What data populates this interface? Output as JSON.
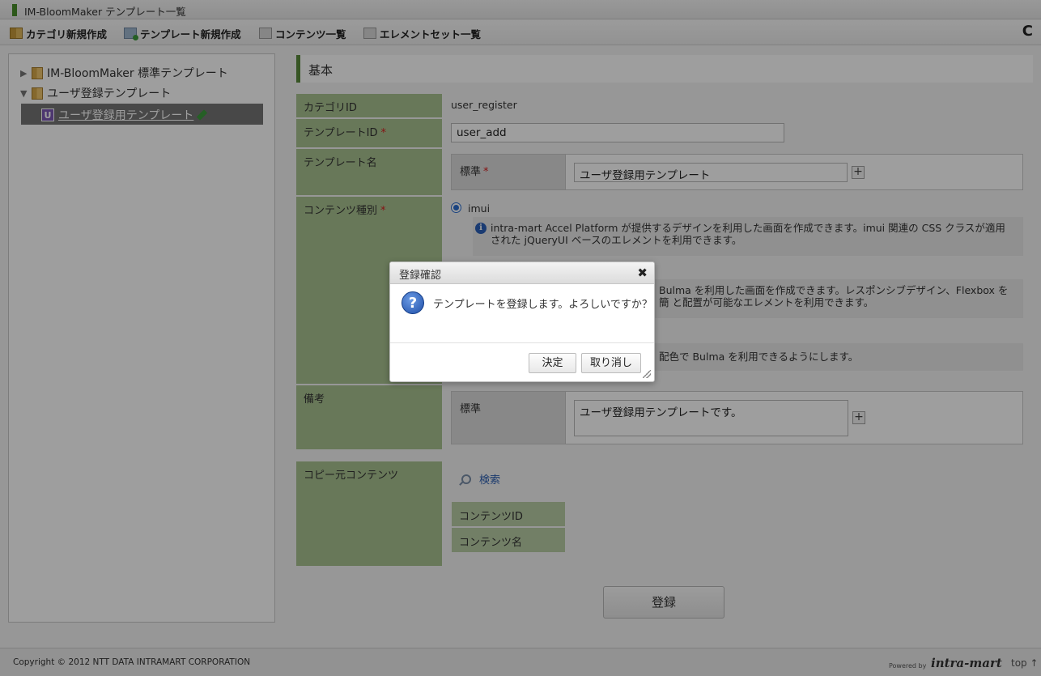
{
  "window": {
    "title": "IM-BloomMaker テンプレート一覧"
  },
  "toolbar": {
    "category_new": "カテゴリ新規作成",
    "template_new": "テンプレート新規作成",
    "contents_list": "コンテンツ一覧",
    "elementset_list": "エレメントセット一覧",
    "reload_icon": "C"
  },
  "tree": {
    "items": [
      {
        "label": "IM-BloomMaker 標準テンプレート",
        "expanded": false
      },
      {
        "label": "ユーザ登録テンプレート",
        "expanded": true
      },
      {
        "label": "ユーザ登録用テンプレート",
        "badge": "U",
        "selected": true
      }
    ]
  },
  "form": {
    "section_title": "基本",
    "category_id_label": "カテゴリID",
    "category_id_value": "user_register",
    "template_id_label": "テンプレートID",
    "template_id_value": "user_add",
    "template_name_label": "テンプレート名",
    "template_name_locale": "標準",
    "template_name_value": "ユーザ登録用テンプレート",
    "content_type_label": "コンテンツ種別",
    "content_type_selected": "imui",
    "imui_description": "intra-mart Accel Platform が提供するデザインを利用した画面を作成できます。imui 関連の CSS クラスが適用された jQueryUI ベースのエレメントを利用できます。",
    "bulma_description_partial": "Bulma を利用した画面を作成できます。レスポンシブデザイン、Flexbox を簡 と配置が可能なエレメントを利用できます。",
    "third_description_partial": "配色で Bulma を利用できるようにします。",
    "remarks_label": "備考",
    "remarks_locale": "標準",
    "remarks_value": "ユーザ登録用テンプレートです。",
    "copy_source_label": "コピー元コンテンツ",
    "search_link": "検索",
    "content_id_label": "コンテンツID",
    "content_name_label": "コンテンツ名",
    "register_button": "登録",
    "required_mark": "*",
    "plus": "+"
  },
  "dialog": {
    "title": "登録確認",
    "message": "テンプレートを登録します。よろしいですか？",
    "ok_button": "決定",
    "cancel_button": "取り消し",
    "question_glyph": "?"
  },
  "footer": {
    "copyright": "Copyright © 2012 NTT DATA INTRAMART CORPORATION",
    "powered_by": "Powered by",
    "brand": "intra-mart",
    "top_link": "top ↑"
  },
  "colors": {
    "label_green": "#a9c290",
    "accent_green": "#5a8a3a",
    "link_blue": "#2a5db0",
    "required_red": "#d62020"
  }
}
